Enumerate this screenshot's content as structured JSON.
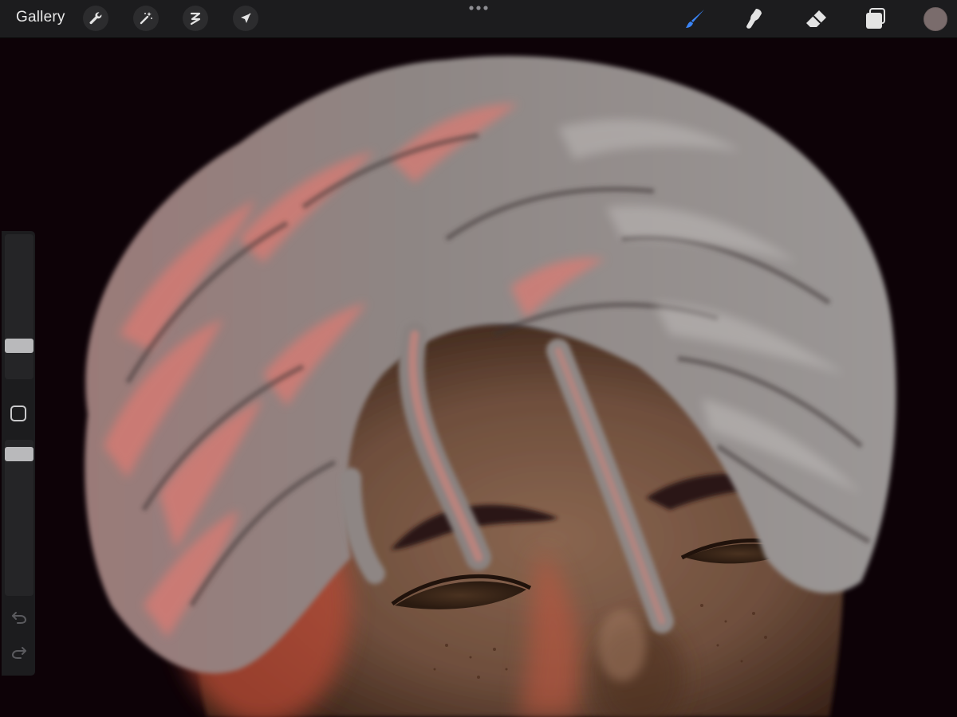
{
  "toolbar": {
    "gallery_label": "Gallery",
    "left_tools": [
      {
        "icon": "wrench-icon",
        "name": "actions"
      },
      {
        "icon": "magic-wand-icon",
        "name": "adjustments"
      },
      {
        "icon": "selection-icon",
        "name": "selection"
      },
      {
        "icon": "arrow-cursor-icon",
        "name": "transform"
      }
    ],
    "more_icon": "more-dots-icon",
    "right_tools": [
      {
        "icon": "brush-icon",
        "name": "paint",
        "active": true
      },
      {
        "icon": "smudge-icon",
        "name": "smudge",
        "active": false
      },
      {
        "icon": "eraser-icon",
        "name": "eraser",
        "active": false
      },
      {
        "icon": "layers-icon",
        "name": "layers",
        "active": false
      }
    ],
    "current_color": "#7a6c6c"
  },
  "sidebar": {
    "brush_size_level": 0.2,
    "opacity_level": 0.95,
    "modify_icon": "square-icon",
    "undo_icon": "undo-icon",
    "redo_icon": "redo-icon"
  },
  "colors": {
    "accent": "#3a84f5",
    "canvas_background": "#0d0207",
    "toolbar_background": "#1c1c1e"
  }
}
